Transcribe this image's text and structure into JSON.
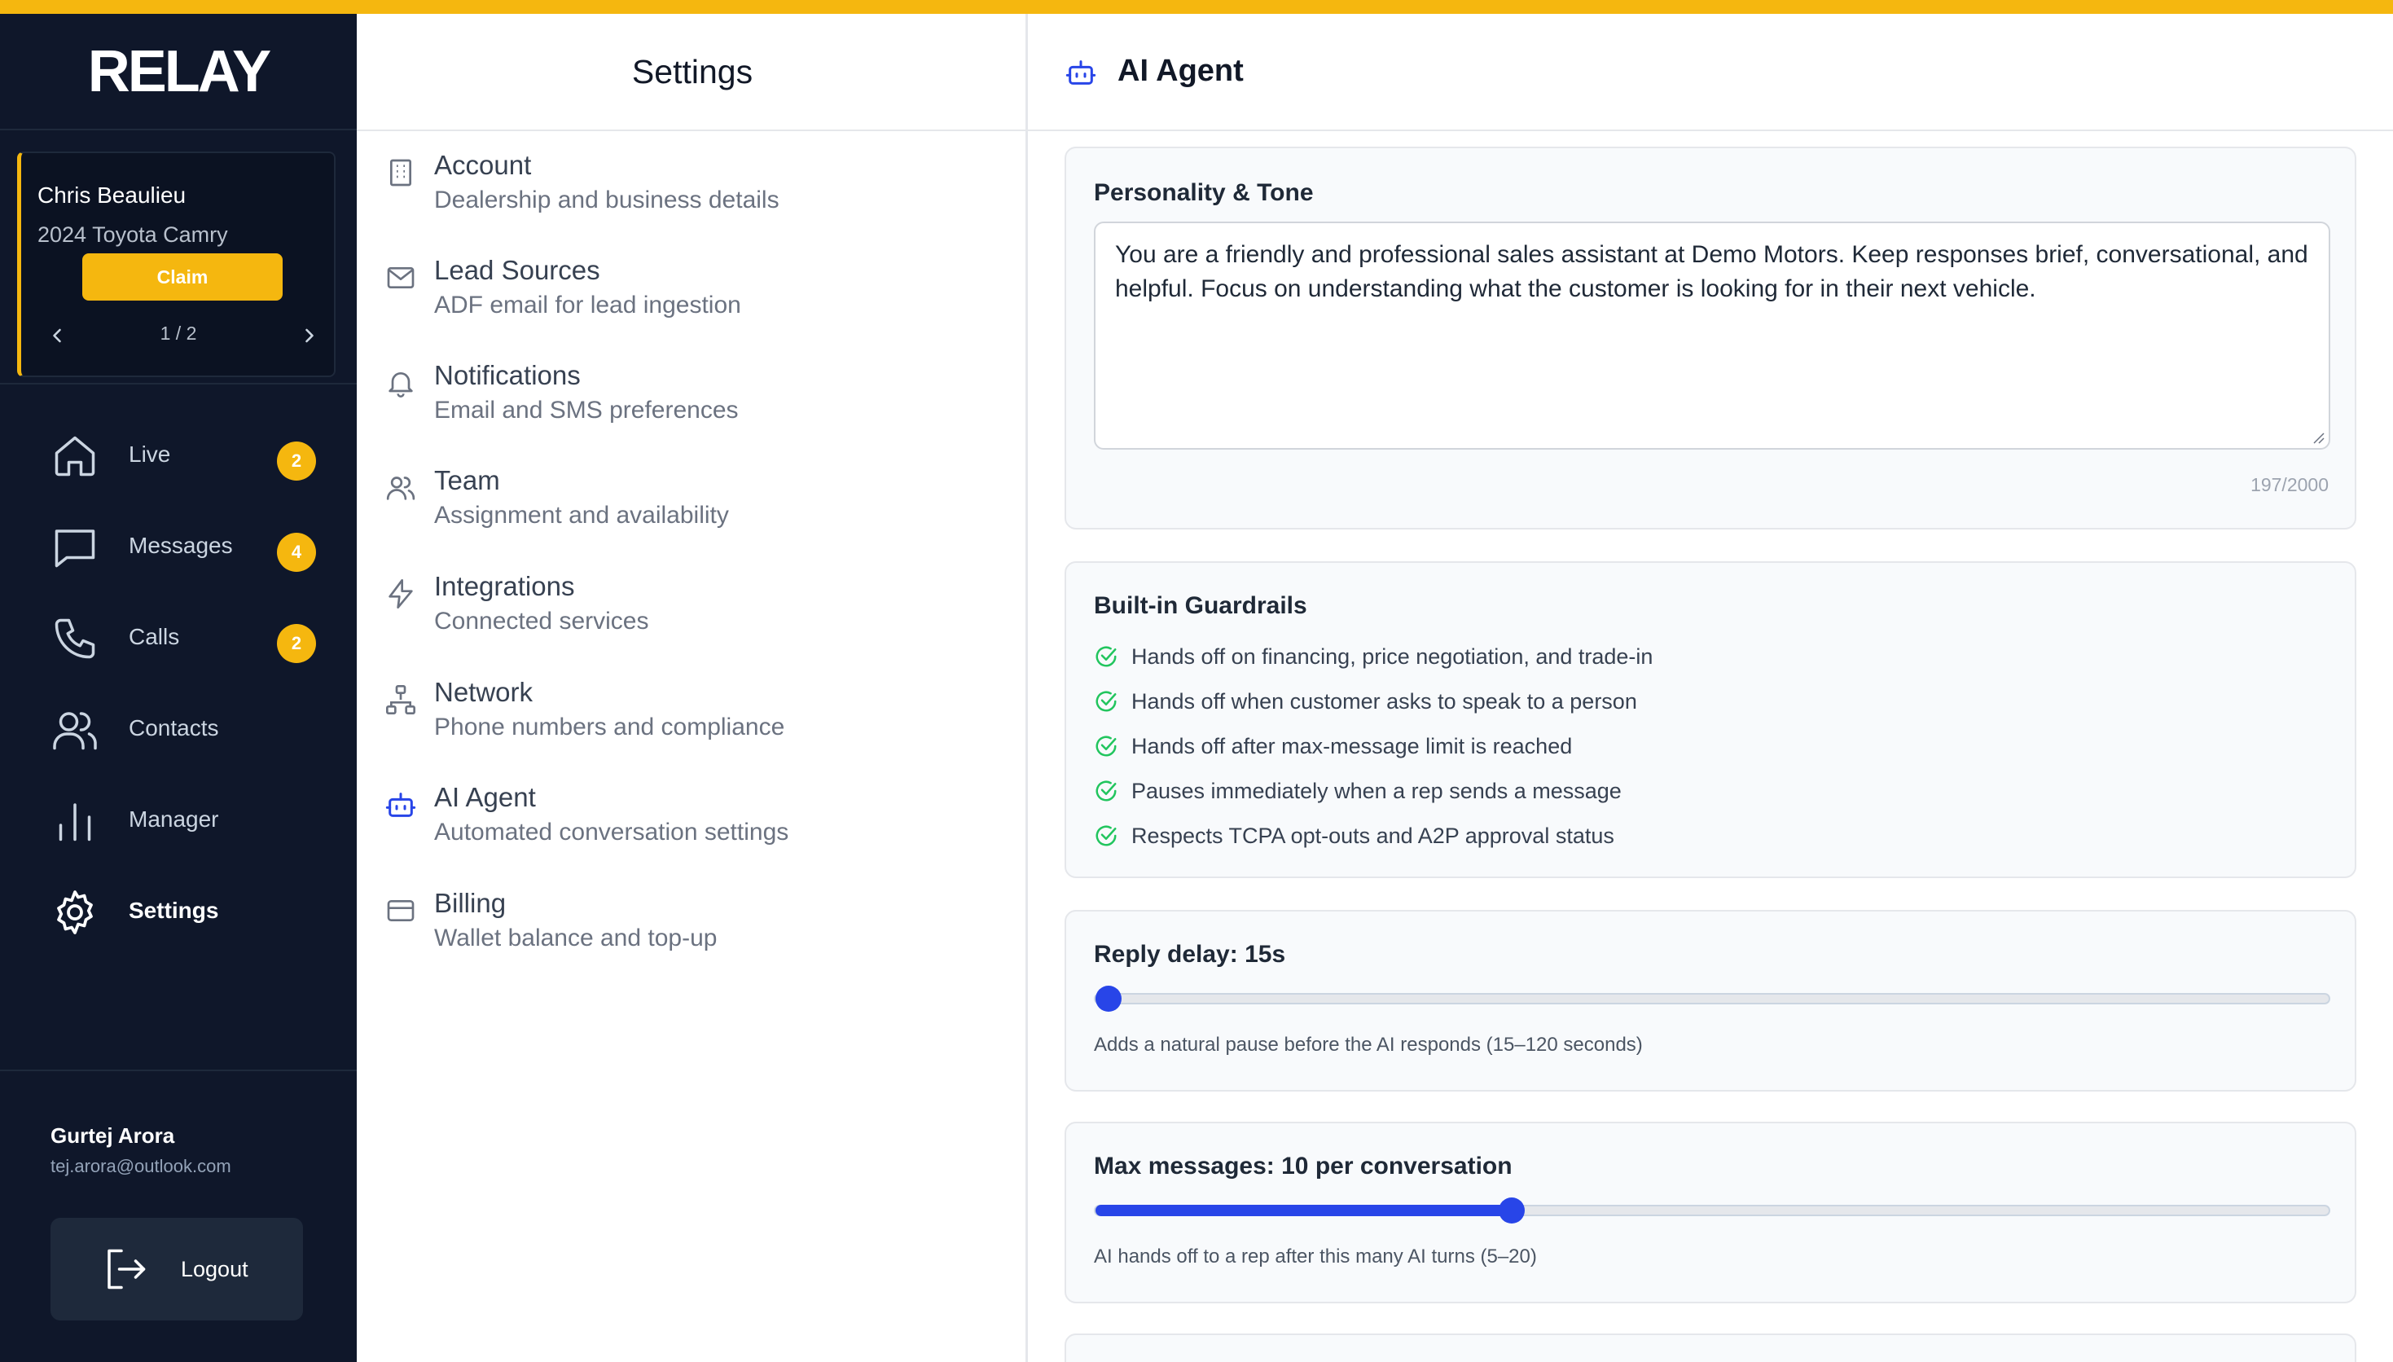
{
  "app": {
    "logo": "RELAY",
    "accent_color": "#f5b70f",
    "primary_color": "#2845e8"
  },
  "claim": {
    "name": "Chris Beaulieu",
    "vehicle": "2024 Toyota Camry",
    "button_label": "Claim",
    "page": "1 / 2"
  },
  "nav": {
    "items": [
      {
        "label": "Live",
        "icon": "home-icon",
        "badge": "2"
      },
      {
        "label": "Messages",
        "icon": "message-icon",
        "badge": "4"
      },
      {
        "label": "Calls",
        "icon": "phone-icon",
        "badge": "2"
      },
      {
        "label": "Contacts",
        "icon": "users-icon",
        "badge": ""
      },
      {
        "label": "Manager",
        "icon": "bar-chart-icon",
        "badge": ""
      },
      {
        "label": "Settings",
        "icon": "gear-icon",
        "badge": "",
        "active": true
      }
    ]
  },
  "user": {
    "name": "Gurtej Arora",
    "email": "tej.arora@outlook.com",
    "logout_label": "Logout"
  },
  "settings": {
    "title": "Settings",
    "items": [
      {
        "title": "Account",
        "subtitle": "Dealership and business details",
        "icon": "building-icon"
      },
      {
        "title": "Lead Sources",
        "subtitle": "ADF email for lead ingestion",
        "icon": "mail-icon"
      },
      {
        "title": "Notifications",
        "subtitle": "Email and SMS preferences",
        "icon": "bell-icon"
      },
      {
        "title": "Team",
        "subtitle": "Assignment and availability",
        "icon": "team-icon"
      },
      {
        "title": "Integrations",
        "subtitle": "Connected services",
        "icon": "bolt-icon"
      },
      {
        "title": "Network",
        "subtitle": "Phone numbers and compliance",
        "icon": "network-icon"
      },
      {
        "title": "AI Agent",
        "subtitle": "Automated conversation settings",
        "icon": "robot-icon",
        "active": true
      },
      {
        "title": "Billing",
        "subtitle": "Wallet balance and top-up",
        "icon": "credit-card-icon"
      }
    ]
  },
  "main": {
    "title": "AI Agent",
    "personality": {
      "title": "Personality & Tone",
      "text": "You are a friendly and professional sales assistant at Demo Motors. Keep responses brief, conversational, and helpful. Focus on understanding what the customer is looking for in their next vehicle.",
      "counter": "197/2000"
    },
    "guardrails": {
      "title": "Built-in Guardrails",
      "items": [
        "Hands off on financing, price negotiation, and trade-in",
        "Hands off when customer asks to speak to a person",
        "Hands off after max-message limit is reached",
        "Pauses immediately when a rep sends a message",
        "Respects TCPA opt-outs and A2P approval status"
      ]
    },
    "reply_delay": {
      "label": "Reply delay: 15s",
      "value": 15,
      "min": 15,
      "max": 120,
      "hint": "Adds a natural pause before the AI responds (15–120 seconds)"
    },
    "max_messages": {
      "label": "Max messages: 10 per conversation",
      "value": 10,
      "min": 5,
      "max": 20,
      "hint": "AI hands off to a rep after this many AI turns (5–20)"
    }
  }
}
